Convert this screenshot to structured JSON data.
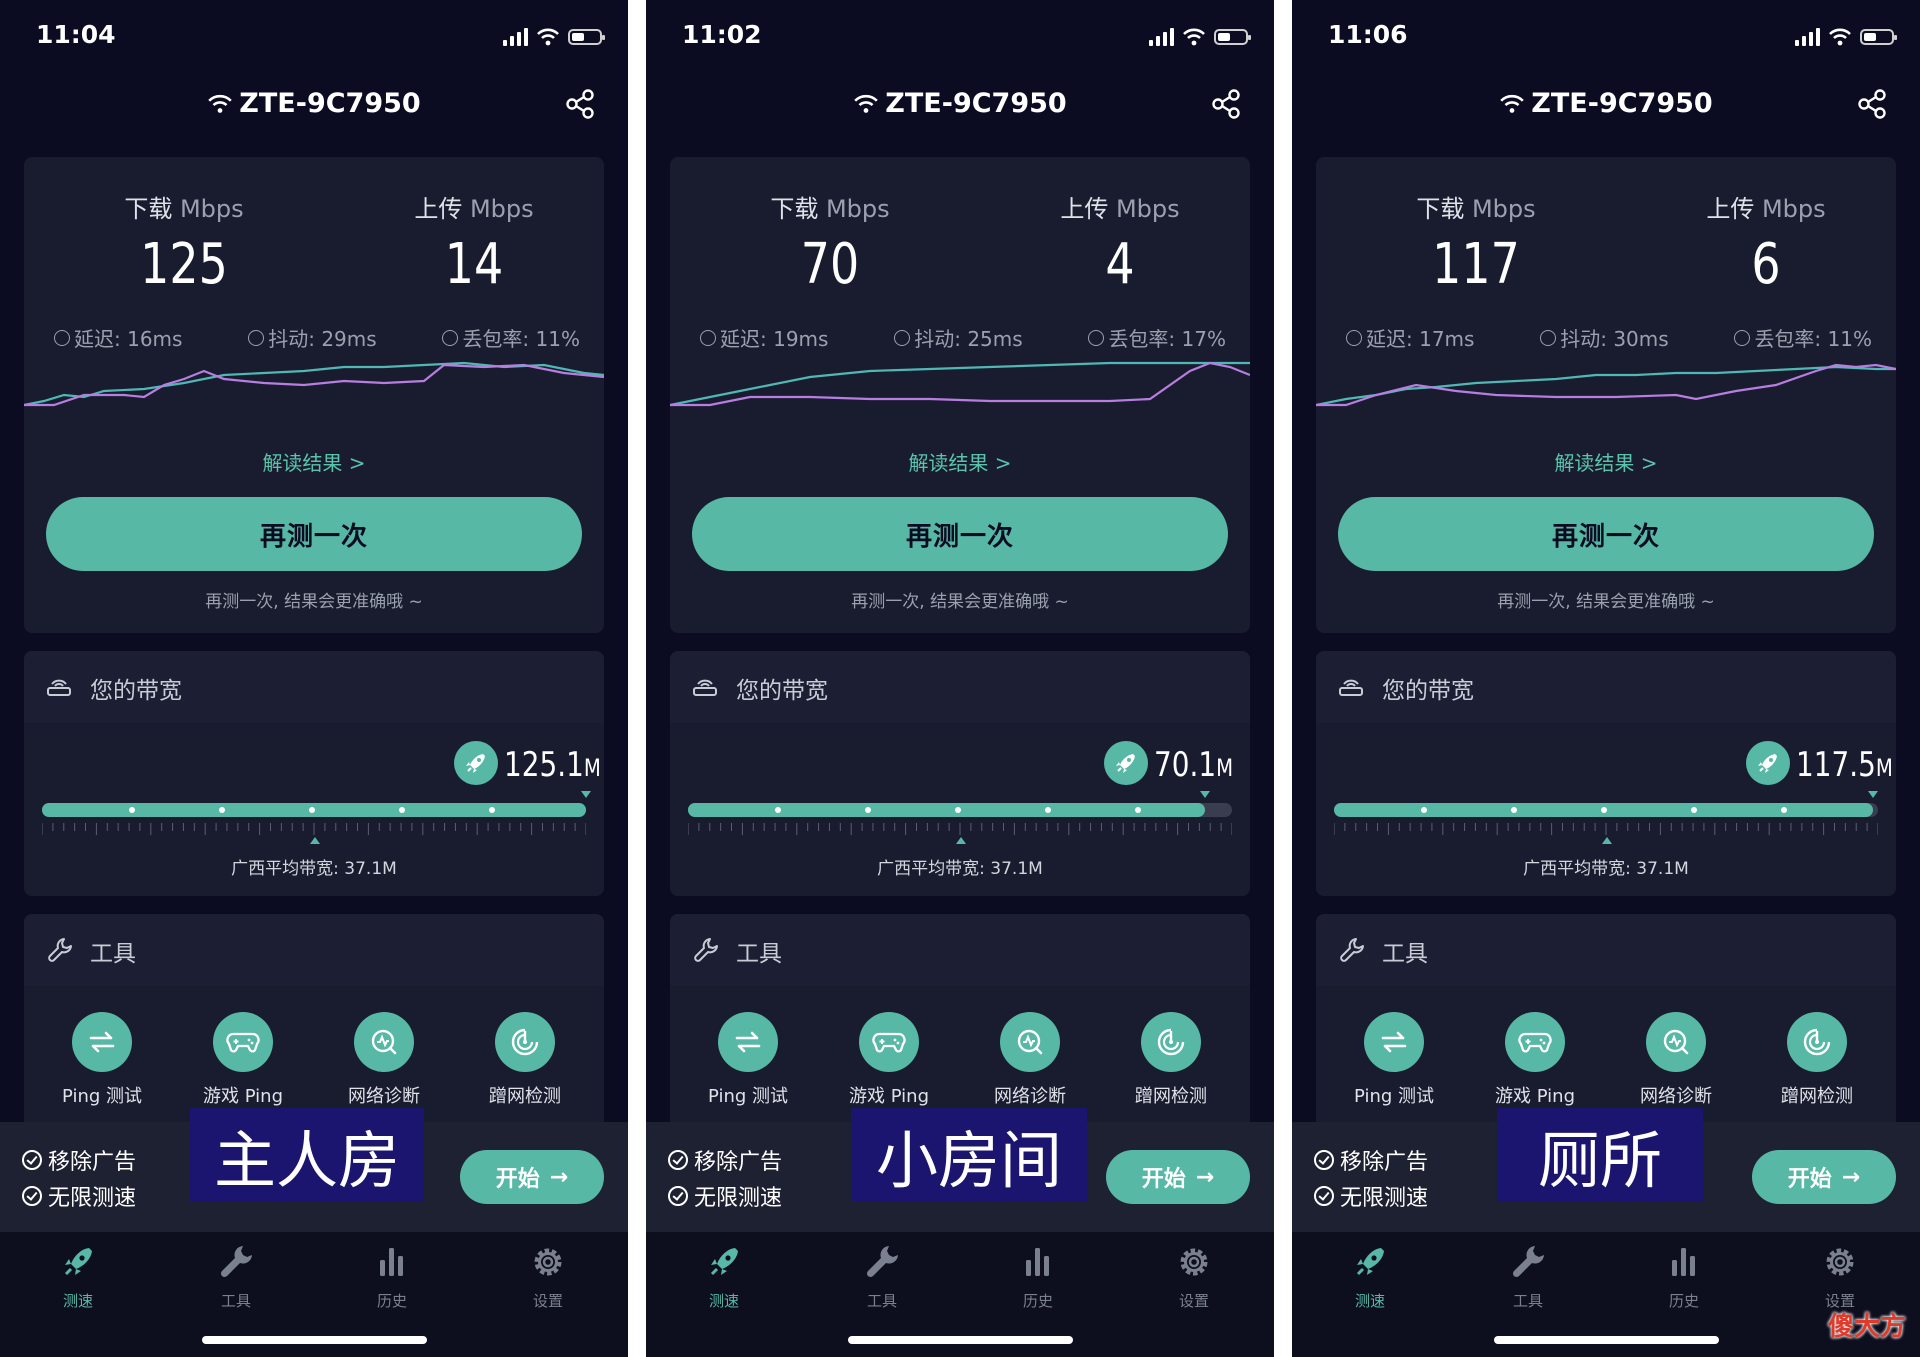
{
  "panels": [
    {
      "status_time": "11:04",
      "ssid": "ZTE-9C7950",
      "download_label": "下载",
      "upload_label": "上传",
      "unit": "Mbps",
      "download": "125",
      "upload": "14",
      "latency": "延迟: 16ms",
      "jitter": "抖动: 29ms",
      "loss": "丢包率: 11%",
      "explain": "解读结果 >",
      "retest": "再测一次",
      "retest_hint": "再测一次, 结果会更准确哦 ~",
      "bandwidth_title": "您的带宽",
      "bandwidth_value": "125.1",
      "bandwidth_unit": "M",
      "bandwidth_fill": 1.0,
      "avg_label": "广西平均带宽: 37.1M",
      "tools_title": "工具",
      "tools": [
        "Ping 测试",
        "游戏 Ping",
        "网络诊断",
        "蹭网检测"
      ],
      "promo": [
        "移除广告",
        "无限测速"
      ],
      "start": "开始",
      "room_label": "主人房",
      "tabs": [
        "测速",
        "工具",
        "历史",
        "设置"
      ]
    },
    {
      "status_time": "11:02",
      "ssid": "ZTE-9C7950",
      "download_label": "下载",
      "upload_label": "上传",
      "unit": "Mbps",
      "download": "70",
      "upload": "4",
      "latency": "延迟: 19ms",
      "jitter": "抖动: 25ms",
      "loss": "丢包率: 17%",
      "explain": "解读结果 >",
      "retest": "再测一次",
      "retest_hint": "再测一次, 结果会更准确哦 ~",
      "bandwidth_title": "您的带宽",
      "bandwidth_value": "70.1",
      "bandwidth_unit": "M",
      "bandwidth_fill": 0.95,
      "avg_label": "广西平均带宽: 37.1M",
      "tools_title": "工具",
      "tools": [
        "Ping 测试",
        "游戏 Ping",
        "网络诊断",
        "蹭网检测"
      ],
      "promo": [
        "移除广告",
        "无限测速"
      ],
      "start": "开始",
      "room_label": "小房间",
      "tabs": [
        "测速",
        "工具",
        "历史",
        "设置"
      ]
    },
    {
      "status_time": "11:06",
      "ssid": "ZTE-9C7950",
      "download_label": "下载",
      "upload_label": "上传",
      "unit": "Mbps",
      "download": "117",
      "upload": "6",
      "latency": "延迟: 17ms",
      "jitter": "抖动: 30ms",
      "loss": "丢包率: 11%",
      "explain": "解读结果 >",
      "retest": "再测一次",
      "retest_hint": "再测一次, 结果会更准确哦 ~",
      "bandwidth_title": "您的带宽",
      "bandwidth_value": "117.5",
      "bandwidth_unit": "M",
      "bandwidth_fill": 0.99,
      "avg_label": "广西平均带宽: 37.1M",
      "tools_title": "工具",
      "tools": [
        "Ping 测试",
        "游戏 Ping",
        "网络诊断",
        "蹭网检测"
      ],
      "promo": [
        "移除广告",
        "无限测速"
      ],
      "start": "开始",
      "room_label": "厕所",
      "tabs": [
        "测速",
        "工具",
        "历史",
        "设置"
      ]
    }
  ],
  "watermark": "傻大方",
  "colors": {
    "background": "#0b0b22",
    "card": "#191c2f",
    "accent": "#57b8a5",
    "download_line": "#4fb8b4",
    "upload_line": "#b77ee0"
  },
  "icons": {
    "share": "share-icon",
    "wifi": "wifi-icon",
    "router": "router-icon",
    "wrench": "wrench-icon",
    "rocket": "rocket-icon"
  }
}
